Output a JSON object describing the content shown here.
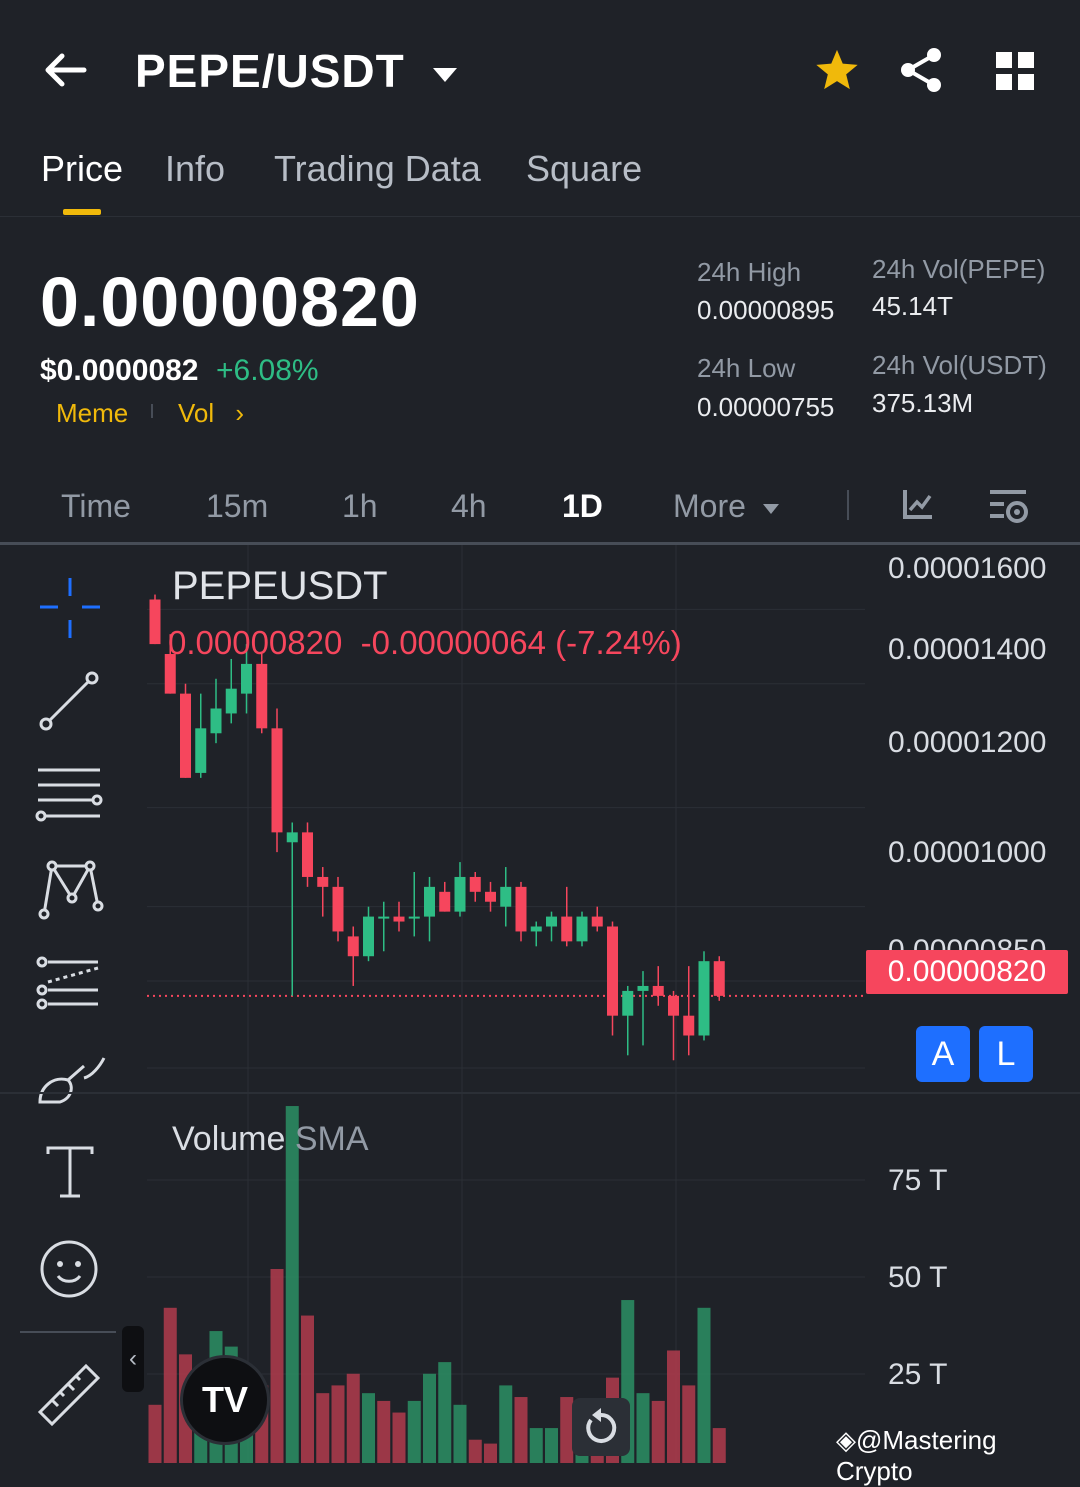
{
  "header": {
    "title": "PEPE/USDT",
    "icons": [
      "back-arrow-icon",
      "chevron-down-icon",
      "star-icon",
      "share-icon",
      "grid-icon"
    ],
    "star_color": "#f0b90b"
  },
  "tabs": [
    {
      "label": "Price",
      "active": true
    },
    {
      "label": "Info",
      "active": false
    },
    {
      "label": "Trading Data",
      "active": false
    },
    {
      "label": "Square",
      "active": false
    }
  ],
  "price": {
    "last": "0.00000820",
    "usd": "$0.0000082",
    "change_pct": "+6.08%",
    "tags": [
      "Meme",
      "Vol"
    ]
  },
  "stats": {
    "high_label": "24h High",
    "high_value": "0.00000895",
    "low_label": "24h Low",
    "low_value": "0.00000755",
    "vol_base_label": "24h Vol(PEPE)",
    "vol_base_value": "45.14T",
    "vol_quote_label": "24h Vol(USDT)",
    "vol_quote_value": "375.13M"
  },
  "intervals": [
    {
      "label": "Time",
      "active": false
    },
    {
      "label": "15m",
      "active": false
    },
    {
      "label": "1h",
      "active": false
    },
    {
      "label": "4h",
      "active": false
    },
    {
      "label": "1D",
      "active": true
    },
    {
      "label": "More",
      "active": false
    }
  ],
  "chart": {
    "symbol": "PEPEUSDT",
    "ohlc_text": "0.00000820  -0.00000064 (-7.24%)",
    "price_axis": [
      "0.00001600",
      "0.00001400",
      "0.00001200",
      "0.00001000",
      "0.00000850"
    ],
    "current_price_tag": "0.00000820",
    "buttons": [
      "A",
      "L"
    ],
    "volume_label": "Volume",
    "volume_sma_label": "SMA",
    "volume_axis": [
      "75 T",
      "50 T",
      "25 T"
    ],
    "up_color": "#2ebd85",
    "down_color": "#f6465d"
  },
  "chart_data": {
    "type": "candlestick",
    "symbol": "PEPEUSDT",
    "candles": [
      {
        "o": 1.62e-05,
        "h": 1.63e-05,
        "l": 1.53e-05,
        "c": 1.53e-05
      },
      {
        "o": 1.51e-05,
        "h": 1.55e-05,
        "l": 1.43e-05,
        "c": 1.43e-05
      },
      {
        "o": 1.43e-05,
        "h": 1.45e-05,
        "l": 1.26e-05,
        "c": 1.26e-05
      },
      {
        "o": 1.27e-05,
        "h": 1.43e-05,
        "l": 1.26e-05,
        "c": 1.36e-05
      },
      {
        "o": 1.35e-05,
        "h": 1.46e-05,
        "l": 1.33e-05,
        "c": 1.4e-05
      },
      {
        "o": 1.39e-05,
        "h": 1.5e-05,
        "l": 1.37e-05,
        "c": 1.44e-05
      },
      {
        "o": 1.43e-05,
        "h": 1.53e-05,
        "l": 1.39e-05,
        "c": 1.49e-05
      },
      {
        "o": 1.49e-05,
        "h": 1.51e-05,
        "l": 1.35e-05,
        "c": 1.36e-05
      },
      {
        "o": 1.36e-05,
        "h": 1.4e-05,
        "l": 1.11e-05,
        "c": 1.15e-05
      },
      {
        "o": 1.13e-05,
        "h": 1.17e-05,
        "l": 8.2e-06,
        "c": 1.15e-05
      },
      {
        "o": 1.15e-05,
        "h": 1.17e-05,
        "l": 1.04e-05,
        "c": 1.06e-05
      },
      {
        "o": 1.06e-05,
        "h": 1.08e-05,
        "l": 9.8e-06,
        "c": 1.04e-05
      },
      {
        "o": 1.04e-05,
        "h": 1.06e-05,
        "l": 9.3e-06,
        "c": 9.5e-06
      },
      {
        "o": 9.4e-06,
        "h": 9.6e-06,
        "l": 8.4e-06,
        "c": 9e-06
      },
      {
        "o": 9e-06,
        "h": 1e-05,
        "l": 8.9e-06,
        "c": 9.8e-06
      },
      {
        "o": 9.8e-06,
        "h": 1.01e-05,
        "l": 9.1e-06,
        "c": 9.8e-06
      },
      {
        "o": 9.8e-06,
        "h": 1.01e-05,
        "l": 9.5e-06,
        "c": 9.7e-06
      },
      {
        "o": 9.8e-06,
        "h": 1.07e-05,
        "l": 9.4e-06,
        "c": 9.8e-06
      },
      {
        "o": 9.8e-06,
        "h": 1.06e-05,
        "l": 9.3e-06,
        "c": 1.04e-05
      },
      {
        "o": 1.03e-05,
        "h": 1.05e-05,
        "l": 9.9e-06,
        "c": 9.9e-06
      },
      {
        "o": 9.9e-06,
        "h": 1.09e-05,
        "l": 9.8e-06,
        "c": 1.06e-05
      },
      {
        "o": 1.06e-05,
        "h": 1.07e-05,
        "l": 1.01e-05,
        "c": 1.03e-05
      },
      {
        "o": 1.03e-05,
        "h": 1.05e-05,
        "l": 9.9e-06,
        "c": 1.01e-05
      },
      {
        "o": 1e-05,
        "h": 1.08e-05,
        "l": 9.6e-06,
        "c": 1.04e-05
      },
      {
        "o": 1.04e-05,
        "h": 1.05e-05,
        "l": 9.3e-06,
        "c": 9.5e-06
      },
      {
        "o": 9.5e-06,
        "h": 9.7e-06,
        "l": 9.2e-06,
        "c": 9.6e-06
      },
      {
        "o": 9.6e-06,
        "h": 9.9e-06,
        "l": 9.3e-06,
        "c": 9.8e-06
      },
      {
        "o": 9.8e-06,
        "h": 1.04e-05,
        "l": 9.2e-06,
        "c": 9.3e-06
      },
      {
        "o": 9.3e-06,
        "h": 9.9e-06,
        "l": 9.2e-06,
        "c": 9.8e-06
      },
      {
        "o": 9.8e-06,
        "h": 1e-05,
        "l": 9.5e-06,
        "c": 9.6e-06
      },
      {
        "o": 9.6e-06,
        "h": 9.7e-06,
        "l": 7.4e-06,
        "c": 7.8e-06
      },
      {
        "o": 7.8e-06,
        "h": 8.4e-06,
        "l": 7e-06,
        "c": 8.3e-06
      },
      {
        "o": 8.3e-06,
        "h": 8.7e-06,
        "l": 7.2e-06,
        "c": 8.4e-06
      },
      {
        "o": 8.4e-06,
        "h": 8.8e-06,
        "l": 8e-06,
        "c": 8.2e-06
      },
      {
        "o": 8.2e-06,
        "h": 8.3e-06,
        "l": 6.9e-06,
        "c": 7.8e-06
      },
      {
        "o": 7.8e-06,
        "h": 8.8e-06,
        "l": 7e-06,
        "c": 7.4e-06
      },
      {
        "o": 7.4e-06,
        "h": 9.1e-06,
        "l": 7.3e-06,
        "c": 8.9e-06
      },
      {
        "o": 8.9e-06,
        "h": 9e-06,
        "l": 8.1e-06,
        "c": 8.2e-06
      }
    ],
    "volume": [
      {
        "v": 15,
        "up": false
      },
      {
        "v": 40,
        "up": false
      },
      {
        "v": 28,
        "up": false
      },
      {
        "v": 22,
        "up": true
      },
      {
        "v": 34,
        "up": true
      },
      {
        "v": 30,
        "up": true
      },
      {
        "v": 24,
        "up": true
      },
      {
        "v": 20,
        "up": false
      },
      {
        "v": 50,
        "up": false
      },
      {
        "v": 92,
        "up": true
      },
      {
        "v": 38,
        "up": false
      },
      {
        "v": 18,
        "up": false
      },
      {
        "v": 20,
        "up": false
      },
      {
        "v": 23,
        "up": false
      },
      {
        "v": 18,
        "up": true
      },
      {
        "v": 16,
        "up": false
      },
      {
        "v": 13,
        "up": false
      },
      {
        "v": 16,
        "up": true
      },
      {
        "v": 23,
        "up": true
      },
      {
        "v": 26,
        "up": true
      },
      {
        "v": 15,
        "up": true
      },
      {
        "v": 6,
        "up": false
      },
      {
        "v": 5,
        "up": false
      },
      {
        "v": 20,
        "up": true
      },
      {
        "v": 17,
        "up": false
      },
      {
        "v": 9,
        "up": true
      },
      {
        "v": 9,
        "up": true
      },
      {
        "v": 17,
        "up": false
      },
      {
        "v": 10,
        "up": true
      },
      {
        "v": 6,
        "up": false
      },
      {
        "v": 22,
        "up": false
      },
      {
        "v": 42,
        "up": true
      },
      {
        "v": 18,
        "up": true
      },
      {
        "v": 16,
        "up": false
      },
      {
        "v": 29,
        "up": false
      },
      {
        "v": 20,
        "up": false
      },
      {
        "v": 40,
        "up": true
      },
      {
        "v": 9,
        "up": false
      }
    ],
    "price_range": [
      6.3e-06,
      1.73e-05
    ],
    "volume_range": [
      0,
      100
    ]
  }
}
